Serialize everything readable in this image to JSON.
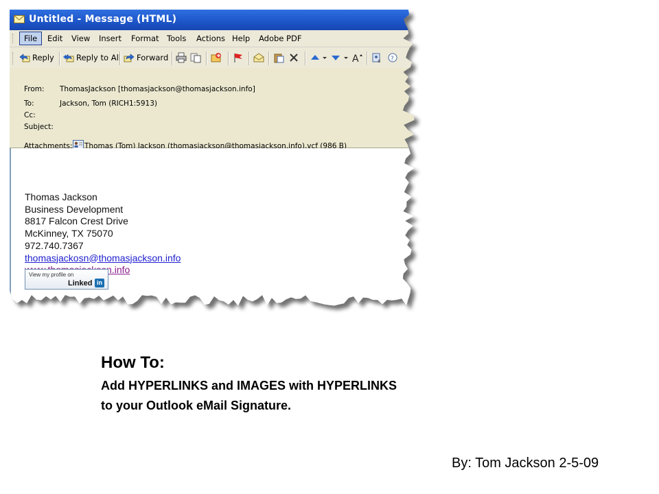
{
  "window": {
    "title": "Untitled - Message (HTML)"
  },
  "menu": {
    "items": [
      "File",
      "Edit",
      "View",
      "Insert",
      "Format",
      "Tools",
      "Actions",
      "Help",
      "Adobe PDF"
    ]
  },
  "toolbar": {
    "reply_label": "Reply",
    "reply_all_label": "Reply to All",
    "forward_label": "Forward"
  },
  "header": {
    "from_label": "From:",
    "from_value": "ThomasJackson [thomasjackson@thomasjackson.info]",
    "to_label": "To:",
    "to_value": "Jackson, Tom (RICH1:5913)",
    "cc_label": "Cc:",
    "subject_label": "Subject:",
    "attachments_label": "Attachments:",
    "attachment_value": "Thomas (Tom) Jackson (thomasjackson@thomasjackson.info).vcf (986 B)"
  },
  "signature": {
    "name": "Thomas Jackson",
    "title": "Business Development",
    "address1": "8817 Falcon Crest Drive",
    "address2": "McKinney, TX 75070",
    "phone": "972.740.7367",
    "email": "thomasjackosn@thomasjackson.info",
    "website": "www.thomasjackson.info",
    "badge_top": "View my profile on",
    "badge_word": "Linked",
    "badge_in": "in"
  },
  "caption": {
    "heading": "How To:",
    "line1": "Add HYPERLINKS and IMAGES with HYPERLINKS",
    "line2": "to your Outlook eMail Signature.",
    "byline": "By: Tom Jackson 2-5-09"
  },
  "colors": {
    "titlebar": "#1d55c8",
    "chrome": "#ece9d8",
    "header_bg": "#ebe8cf",
    "link": "#2020d0",
    "visited_link": "#8a1a8a"
  }
}
